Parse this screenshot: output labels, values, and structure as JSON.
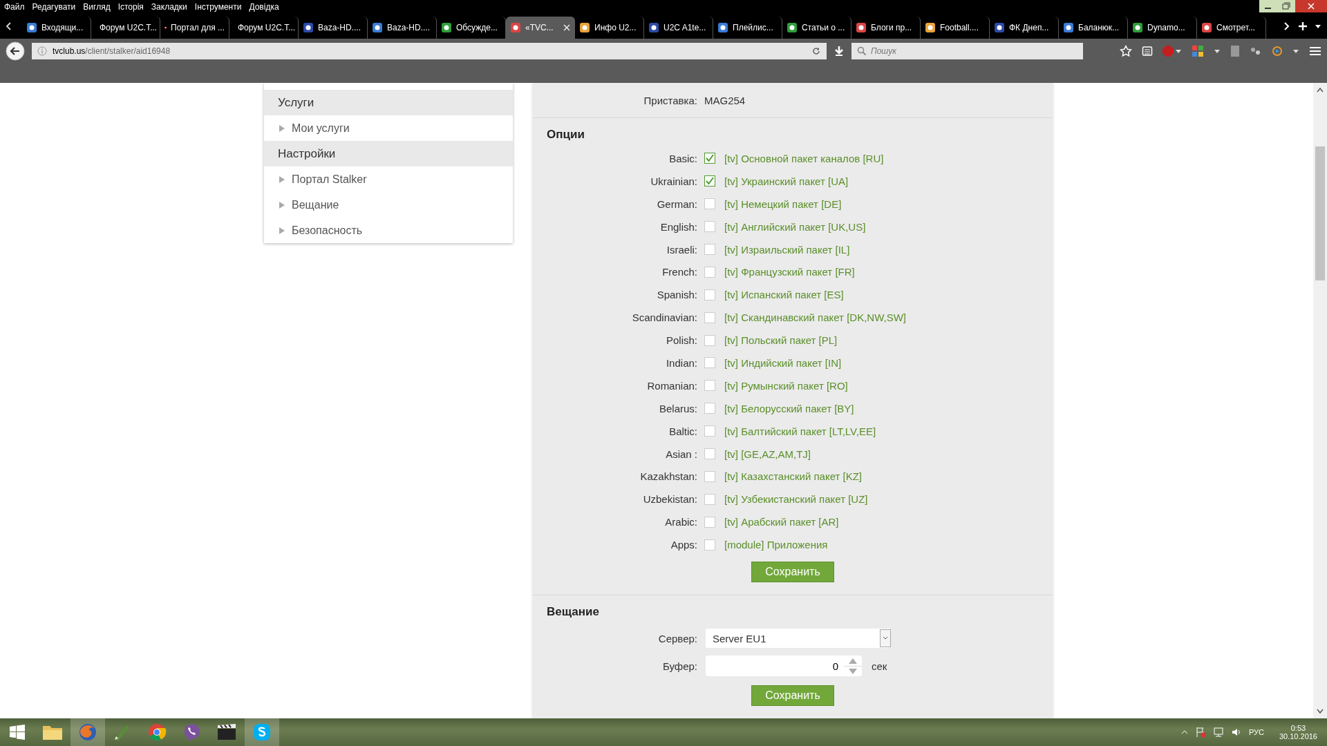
{
  "menu": [
    "Файл",
    "Редагувати",
    "Вигляд",
    "Історія",
    "Закладки",
    "Інструменти",
    "Довідка"
  ],
  "tabs": [
    {
      "title": "Входящи...",
      "selected": false
    },
    {
      "title": "Форум U2C.T...",
      "selected": false
    },
    {
      "title": "Портал для ...",
      "selected": false
    },
    {
      "title": "Форум U2C.T...",
      "selected": false
    },
    {
      "title": "Baza-HD....",
      "selected": false
    },
    {
      "title": "Baza-HD....",
      "selected": false
    },
    {
      "title": "Обсужде...",
      "selected": false
    },
    {
      "title": "«TVC...",
      "selected": true
    },
    {
      "title": "Инфо U2...",
      "selected": false
    },
    {
      "title": "U2C A1te...",
      "selected": false
    },
    {
      "title": "Плейлис...",
      "selected": false
    },
    {
      "title": "Статьи о ...",
      "selected": false
    },
    {
      "title": "Блоги пр...",
      "selected": false
    },
    {
      "title": "Football....",
      "selected": false
    },
    {
      "title": "ФК Днеп...",
      "selected": false
    },
    {
      "title": "Баланюк...",
      "selected": false
    },
    {
      "title": "Dynamo...",
      "selected": false
    },
    {
      "title": "Смотрет...",
      "selected": false
    }
  ],
  "address": {
    "host": "tvclub.us",
    "path": "/client/stalker/aid16948"
  },
  "search": {
    "placeholder": "Пошук"
  },
  "sidebar": [
    {
      "title": "Услуги",
      "items": [
        {
          "label": "Мои услуги"
        }
      ]
    },
    {
      "title": "Настройки",
      "items": [
        {
          "label": "Портал Stalker"
        },
        {
          "label": "Вещание"
        },
        {
          "label": "Безопасность"
        }
      ]
    }
  ],
  "device": {
    "label": "Приставка:",
    "value": "MAG254"
  },
  "options": {
    "title": "Опции",
    "rows": [
      {
        "label": "Basic:",
        "checked": true,
        "text": "[tv] Основной пакет каналов [RU]"
      },
      {
        "label": "Ukrainian:",
        "checked": true,
        "text": "[tv] Украинский пакет [UA]"
      },
      {
        "label": "German:",
        "checked": false,
        "text": "[tv] Немецкий пакет [DE]"
      },
      {
        "label": "English:",
        "checked": false,
        "text": "[tv] Английский пакет [UK,US]"
      },
      {
        "label": "Israeli:",
        "checked": false,
        "text": "[tv] Израильский пакет [IL]"
      },
      {
        "label": "French:",
        "checked": false,
        "text": "[tv] Французский пакет [FR]"
      },
      {
        "label": "Spanish:",
        "checked": false,
        "text": "[tv] Испанский пакет [ES]"
      },
      {
        "label": "Scandinavian:",
        "checked": false,
        "text": "[tv] Скандинавский пакет [DK,NW,SW]"
      },
      {
        "label": "Polish:",
        "checked": false,
        "text": "[tv] Польский пакет [PL]"
      },
      {
        "label": "Indian:",
        "checked": false,
        "text": "[tv] Индийский пакет [IN]"
      },
      {
        "label": "Romanian:",
        "checked": false,
        "text": "[tv] Румынский пакет [RO]"
      },
      {
        "label": "Belarus:",
        "checked": false,
        "text": "[tv] Белорусский пакет [BY]"
      },
      {
        "label": "Baltic:",
        "checked": false,
        "text": "[tv] Балтийский пакет [LT,LV,EE]"
      },
      {
        "label": "Asian :",
        "checked": false,
        "text": "[tv] [GE,AZ,AM,TJ]"
      },
      {
        "label": "Kazakhstan:",
        "checked": false,
        "text": "[tv] Казахстанский пакет [KZ]"
      },
      {
        "label": "Uzbekistan:",
        "checked": false,
        "text": "[tv] Узбекистанский пакет [UZ]"
      },
      {
        "label": "Arabic:",
        "checked": false,
        "text": "[tv] Арабский пакет [AR]"
      },
      {
        "label": "Apps:",
        "checked": false,
        "text": "[module] Приложения"
      }
    ],
    "save": "Сохранить"
  },
  "broadcast": {
    "title": "Вещание",
    "server_label": "Сервер:",
    "server": "Server EU1",
    "buffer_label": "Буфер:",
    "buffer": "0",
    "unit": "сек",
    "save": "Сохранить"
  },
  "tray": {
    "lang": "РУС",
    "time": "0:53",
    "date": "30.10.2016"
  }
}
